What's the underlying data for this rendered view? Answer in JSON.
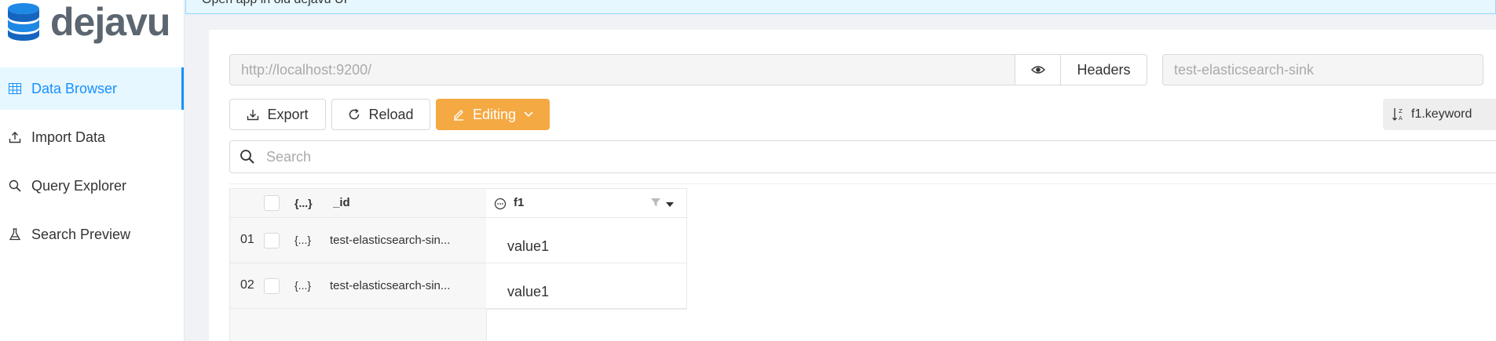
{
  "app": {
    "logo_text": "dejavu"
  },
  "banner": {
    "text": "Open app in old dejavu UI"
  },
  "sidebar": {
    "items": [
      {
        "label": "Data Browser",
        "icon": "table-icon",
        "active": true
      },
      {
        "label": "Import Data",
        "icon": "upload-icon",
        "active": false
      },
      {
        "label": "Query Explorer",
        "icon": "search-icon",
        "active": false
      },
      {
        "label": "Search Preview",
        "icon": "flask-icon",
        "active": false
      }
    ]
  },
  "connection": {
    "url_placeholder": "http://localhost:9200/",
    "headers_label": "Headers",
    "index_placeholder": "test-elasticsearch-sink"
  },
  "toolbar": {
    "export_label": "Export",
    "reload_label": "Reload",
    "editing_label": "Editing",
    "sort_label": "f1.keyword"
  },
  "search": {
    "placeholder": "Search"
  },
  "table": {
    "json_label": "{...}",
    "columns": [
      "_id",
      "f1"
    ],
    "rows": [
      {
        "num": "01",
        "json": "{...}",
        "id": "test-elasticsearch-sin...",
        "f1": "value1"
      },
      {
        "num": "02",
        "json": "{...}",
        "id": "test-elasticsearch-sin...",
        "f1": "value1"
      }
    ]
  },
  "colors": {
    "accent": "#1890ff",
    "editing": "#f5a942",
    "active_bg": "#e6f7ff"
  }
}
